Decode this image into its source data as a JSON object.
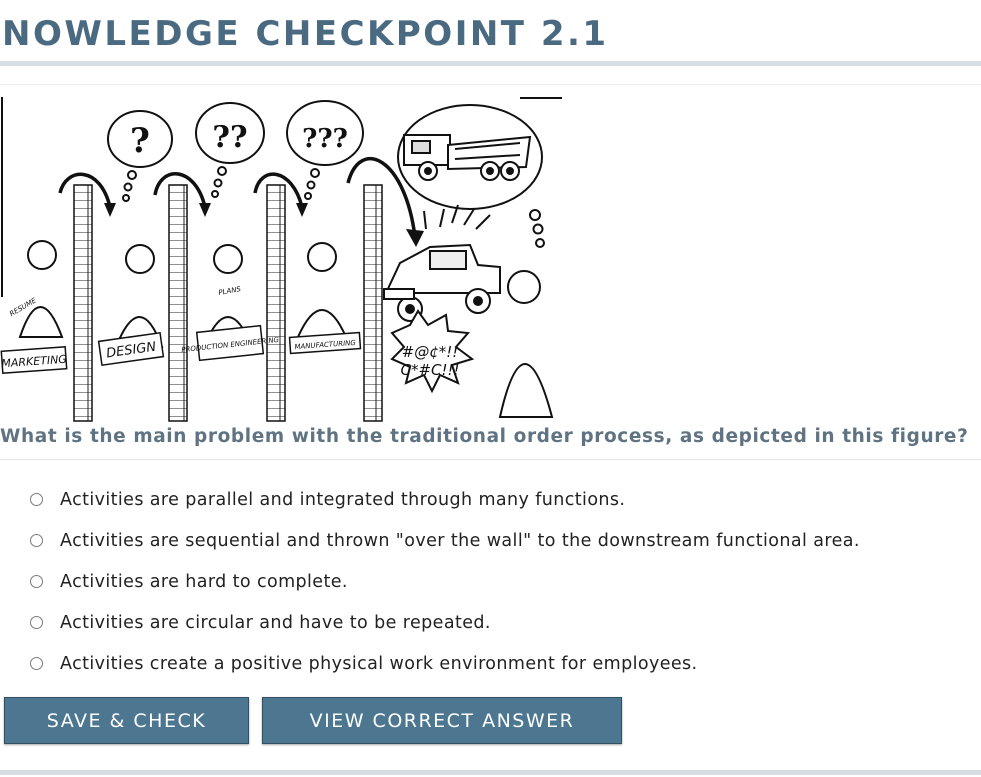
{
  "page": {
    "title": "NOWLEDGE CHECKPOINT 2.1"
  },
  "figure": {
    "function_labels": [
      "MARKETING",
      "DESIGN",
      "PRODUCTION ENGINEERING",
      "MANUFACTURING"
    ],
    "small_labels": [
      "RESUME",
      "PLANS"
    ],
    "exclamation": [
      "#@¢*!!",
      "C*#C!!!"
    ],
    "question_marks": [
      "?",
      "??",
      "???"
    ]
  },
  "question": {
    "text": "What is the main problem with the traditional order process, as depicted in this figure?",
    "options": [
      "Activities are parallel and integrated through many functions.",
      "Activities are sequential and thrown \"over the wall\" to the downstream functional area.",
      "Activities are hard to complete.",
      "Activities are circular and have to be repeated.",
      "Activities create a positive physical work environment for employees."
    ]
  },
  "buttons": {
    "save_check": "SAVE & CHECK",
    "view_answer": "VIEW CORRECT ANSWER"
  },
  "colors": {
    "title": "#4a6a82",
    "button": "#4d7691",
    "question": "#5f7382"
  }
}
